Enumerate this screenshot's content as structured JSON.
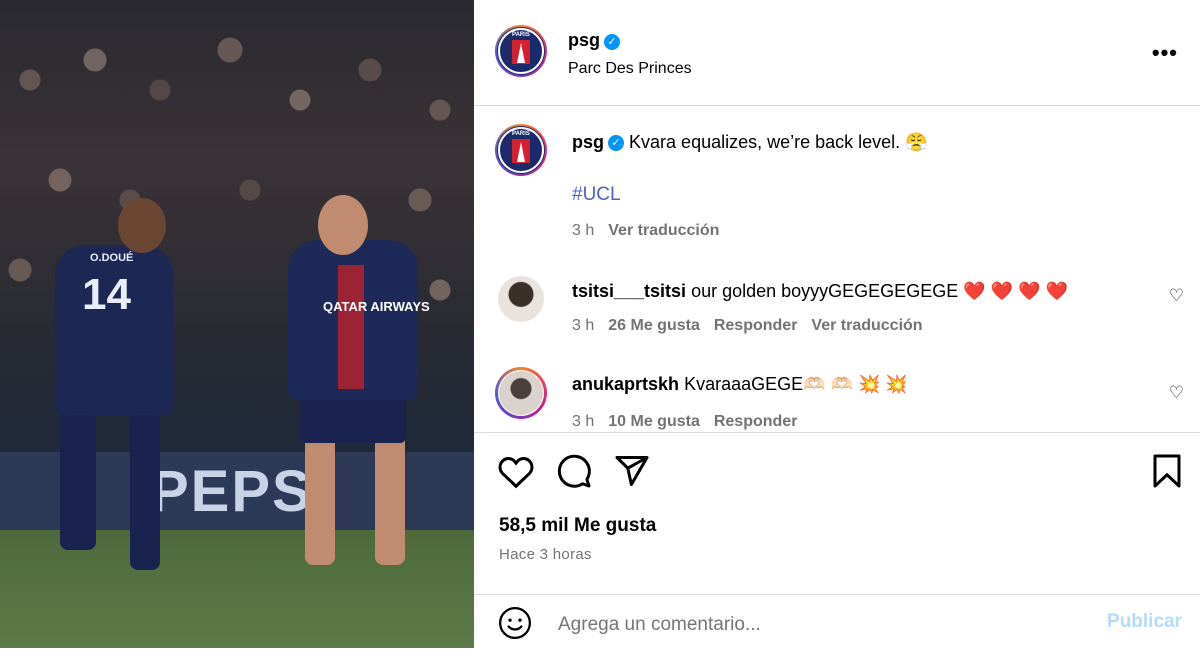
{
  "post": {
    "account": "psg",
    "location": "Parc Des Princes",
    "caption_user": "psg",
    "caption_text": "Kvara equalizes, we’re back level. 😤",
    "hashtag": "#UCL",
    "caption_time": "3 h",
    "caption_translate": "Ver traducción",
    "photo_jersey_name": "O.DOUÉ",
    "photo_jersey_number": "14",
    "photo_sponsor": "QATAR AIRWAYS",
    "photo_board": "PEPS"
  },
  "comments": [
    {
      "user": "tsitsi___tsitsi",
      "text": "our golden boyyyGEGEGEGEGE ❤️ ❤️ ❤️ ❤️",
      "time": "3 h",
      "likes": "26 Me gusta",
      "reply": "Responder",
      "translate": "Ver traducción"
    },
    {
      "user": "anukaprtskh",
      "text": "KvaraaaGEGE🫶🏻 🫶🏻 💥 💥",
      "time": "3 h",
      "likes": "10 Me gusta",
      "reply": "Responder"
    }
  ],
  "stats": {
    "likes": "58,5 mil Me gusta",
    "posted": "Hace 3 horas"
  },
  "composer": {
    "placeholder": "Agrega un comentario...",
    "publish": "Publicar"
  },
  "icons": {
    "more": "more-options-icon",
    "like": "heart-icon",
    "comment": "comment-icon",
    "share": "send-icon",
    "save": "bookmark-icon",
    "emoji": "emoji-icon",
    "verified": "verified-badge-icon"
  },
  "colors": {
    "verified": "#0095f6",
    "hashtag": "#4e61c6",
    "muted": "#737373",
    "publish_disabled": "#b3dbff",
    "heart": "#e8385b"
  }
}
